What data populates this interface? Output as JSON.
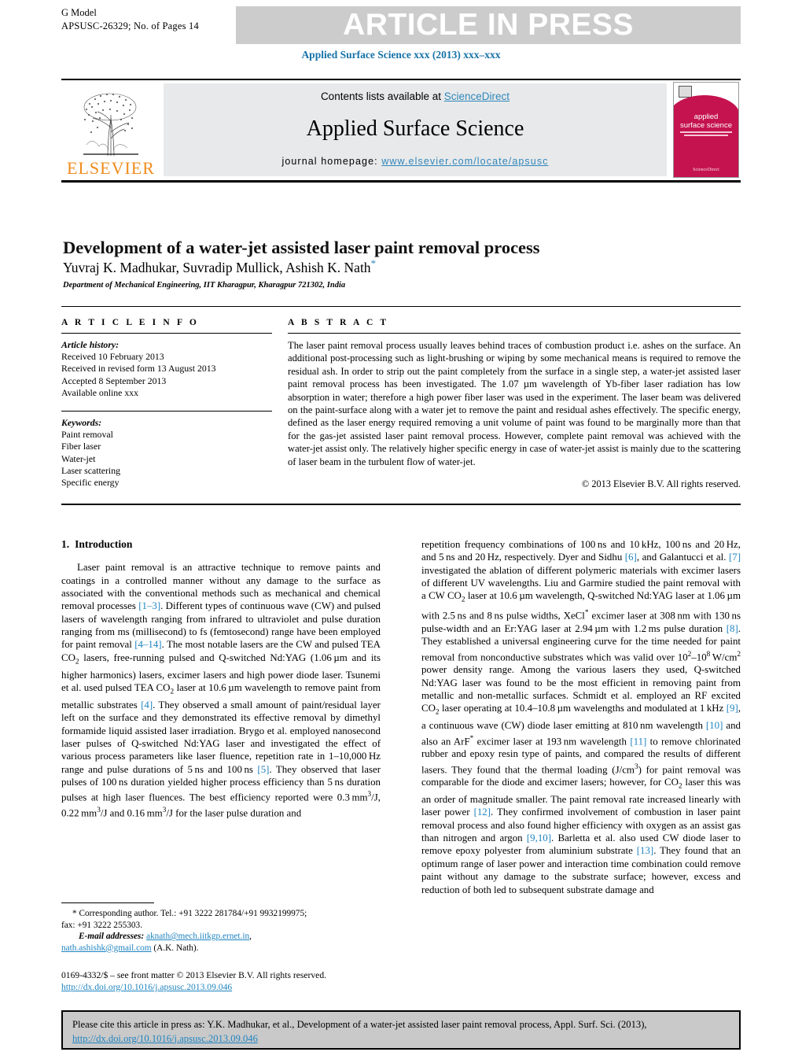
{
  "header": {
    "g_model": "G Model",
    "article_id": "APSUSC-26329;   No. of Pages 14",
    "press_banner": "ARTICLE IN PRESS",
    "journal_ref": "Applied Surface Science xxx (2013) xxx–xxx"
  },
  "masthead": {
    "publisher": "ELSEVIER",
    "contents_prefix": "Contents lists available at ",
    "contents_link": "ScienceDirect",
    "journal_title": "Applied Surface Science",
    "homepage_label": "journal homepage: ",
    "homepage_url": "www.elsevier.com/locate/apsusc",
    "cover_title_line1": "applied",
    "cover_title_line2": "surface science",
    "cover_footer": "ScienceDirect"
  },
  "article": {
    "title": "Development of a water-jet assisted laser paint removal process",
    "authors": "Yuvraj K. Madhukar, Suvradip Mullick, Ashish K. Nath",
    "corresponding_marker": "*",
    "affiliation": "Department of Mechanical Engineering, IIT Kharagpur, Kharagpur 721302, India"
  },
  "article_info": {
    "heading": "A R T I C L E   I N F O",
    "history_label": "Article history:",
    "history": [
      "Received 10 February 2013",
      "Received in revised form 13 August 2013",
      "Accepted 8 September 2013",
      "Available online xxx"
    ],
    "keywords_label": "Keywords:",
    "keywords": [
      "Paint removal",
      "Fiber laser",
      "Water-jet",
      "Laser scattering",
      "Specific energy"
    ]
  },
  "abstract": {
    "heading": "A B S T R A C T",
    "body": "The laser paint removal process usually leaves behind traces of combustion product i.e. ashes on the surface. An additional post-processing such as light-brushing or wiping by some mechanical means is required to remove the residual ash. In order to strip out the paint completely from the surface in a single step, a water-jet assisted laser paint removal process has been investigated. The 1.07 µm wavelength of Yb-fiber laser radiation has low absorption in water; therefore a high power fiber laser was used in the experiment. The laser beam was delivered on the paint-surface along with a water jet to remove the paint and residual ashes effectively. The specific energy, defined as the laser energy required removing a unit volume of paint was found to be marginally more than that for the gas-jet assisted laser paint removal process. However, complete paint removal was achieved with the water-jet assist only. The relatively higher specific energy in case of water-jet assist is mainly due to the scattering of laser beam in the turbulent flow of water-jet.",
    "copyright": "© 2013 Elsevier B.V. All rights reserved."
  },
  "section": {
    "number": "1.",
    "heading": "Introduction"
  },
  "footnote": {
    "corresponding": "* Corresponding author. Tel.: +91 3222 281784/+91 9932199975;",
    "fax": "fax: +91 3222 255303.",
    "email_label": "E-mail addresses:",
    "email1": "aknath@mech.iitkgp.ernet.in",
    "email2": "nath.ashishk@gmail.com",
    "email_owner": "(A.K. Nath)."
  },
  "issn": {
    "line": "0169-4332/$ – see front matter © 2013 Elsevier B.V. All rights reserved.",
    "doi": "http://dx.doi.org/10.1016/j.apsusc.2013.09.046"
  },
  "citation": {
    "text": "Please cite this article in press as: Y.K. Madhukar, et al., Development of a water-jet assisted laser paint removal process, Appl. Surf. Sci. (2013),",
    "doi": "http://dx.doi.org/10.1016/j.apsusc.2013.09.046"
  },
  "colors": {
    "link_blue": "#1f84c0",
    "elsevier_orange": "#f08c1e",
    "cover_crimson": "#c4134f",
    "banner_gray": "#cccccc"
  }
}
